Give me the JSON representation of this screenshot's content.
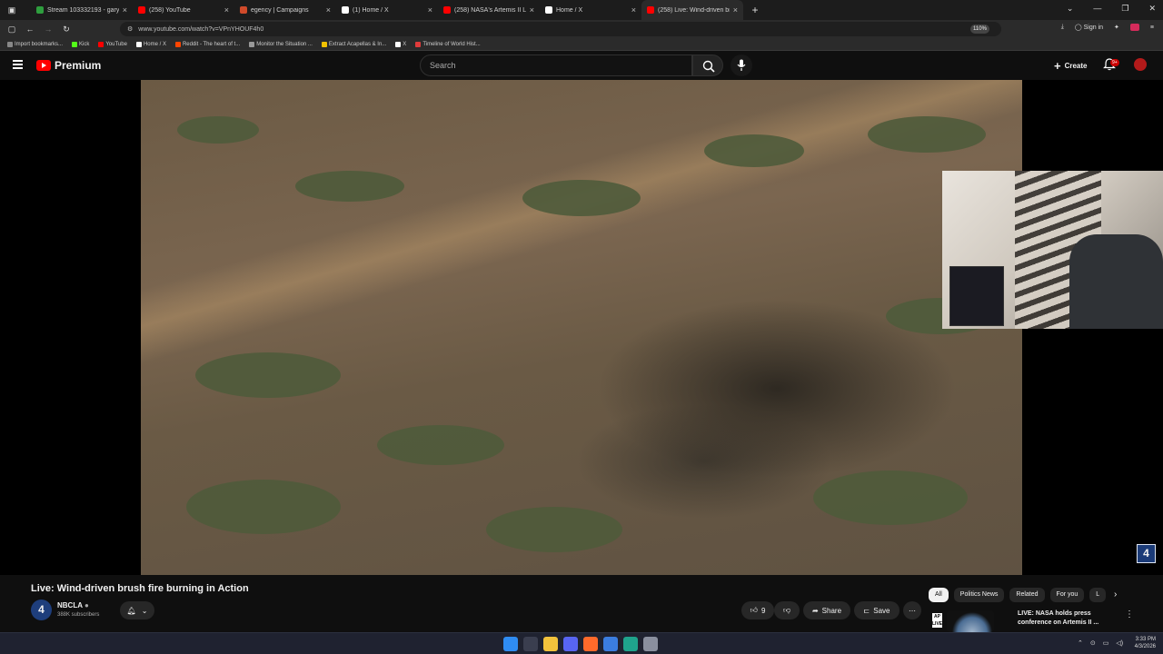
{
  "browser": {
    "tabs": [
      {
        "title": "Stream 103332193 - garydavid",
        "color": "#2e9e3e"
      },
      {
        "title": "(258) YouTube",
        "color": "#ff0000"
      },
      {
        "title": "egency | Campaigns",
        "color": "#d04a2a"
      },
      {
        "title": "(1) Home / X",
        "color": "#ffffff"
      },
      {
        "title": "(258) NASA's Artemis II Live Mi",
        "color": "#ff0000"
      },
      {
        "title": "Home / X",
        "color": "#ffffff"
      },
      {
        "title": "(258) Live: Wind-driven bru",
        "color": "#ff0000",
        "active": true
      }
    ],
    "url": "www.youtube.com/watch?v=VPnYHOUF4h0",
    "zoom": "110%",
    "sign_in": "Sign in",
    "bookmarks": [
      {
        "label": "Import bookmarks...",
        "color": "#888888"
      },
      {
        "label": "Kick",
        "color": "#53fc18"
      },
      {
        "label": "YouTube",
        "color": "#ff0000"
      },
      {
        "label": "Home / X",
        "color": "#ffffff"
      },
      {
        "label": "Reddit - The heart of t...",
        "color": "#ff4500"
      },
      {
        "label": "Monitor the Situation ...",
        "color": "#999999"
      },
      {
        "label": "Extract Acapellas & In...",
        "color": "#f2c200"
      },
      {
        "label": "X",
        "color": "#ffffff"
      },
      {
        "label": "Timeline of World Hist...",
        "color": "#e03b3b"
      }
    ]
  },
  "youtube": {
    "logo_text": "Premium",
    "search_placeholder": "Search",
    "create_label": "Create",
    "notification_badge": "9+"
  },
  "video": {
    "title": "Live: Wind-driven brush fire burning in Action",
    "channel_name": "NBCLA",
    "subscribers": "388K subscribers",
    "channel_avatar_text": "4",
    "likes": "9",
    "share_label": "Share",
    "save_label": "Save",
    "watermark": "4"
  },
  "sidebar": {
    "chips": [
      {
        "label": "All",
        "selected": true
      },
      {
        "label": "Politics News"
      },
      {
        "label": "Related"
      },
      {
        "label": "For you"
      },
      {
        "label": "L"
      }
    ],
    "recommendation": {
      "title": "LIVE: NASA holds press conference on Artemis II ...",
      "badge": "AP LIVE"
    }
  },
  "taskbar": {
    "time": "3:33 PM",
    "date": "4/3/2026",
    "icons": [
      {
        "name": "start-icon",
        "color": "#2f8cf2"
      },
      {
        "name": "search-icon",
        "color": "#3a3e4f"
      },
      {
        "name": "file-explorer-icon",
        "color": "#f2c23c"
      },
      {
        "name": "discord-icon",
        "color": "#5865f2"
      },
      {
        "name": "firefox-icon",
        "color": "#ff6a2b"
      },
      {
        "name": "chrome-icon",
        "color": "#3b7de0"
      },
      {
        "name": "edge-icon",
        "color": "#1fa38c"
      },
      {
        "name": "settings-icon",
        "color": "#8a8f9e"
      }
    ]
  },
  "colors": {
    "youtube_red": "#ff0000",
    "background": "#0f0f0f",
    "chip_bg": "#272727"
  }
}
